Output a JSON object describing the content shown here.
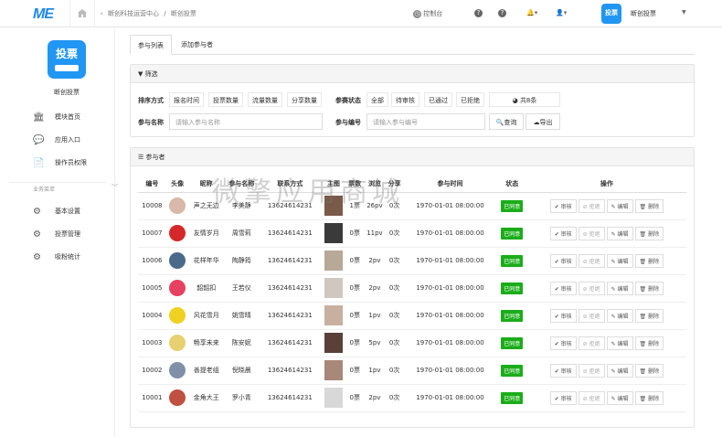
{
  "topbar": {
    "logo": "ME",
    "breadcrumb": [
      "断创科技运营中心",
      "/",
      "断创投票"
    ],
    "console": "控制台",
    "user": "断创投票",
    "avatar_text": "投票"
  },
  "sidebar": {
    "brand_logo_text": "投票",
    "brand_name": "断创投票",
    "items": [
      {
        "label": "模块首页",
        "icon": "bank-icon"
      },
      {
        "label": "应用入口",
        "icon": "chat-icon"
      },
      {
        "label": "操作员权限",
        "icon": "document-icon"
      }
    ],
    "section_label": "业务菜单",
    "biz_items": [
      {
        "label": "基本设置",
        "icon": "gear-icon"
      },
      {
        "label": "投票管理",
        "icon": "gear-icon"
      },
      {
        "label": "吸粉统计",
        "icon": "gear-icon"
      }
    ]
  },
  "tabs": [
    "参与列表",
    "添加参与者"
  ],
  "filter": {
    "title": "筛选",
    "sort_label": "排序方式",
    "sort_options": [
      "报名时间",
      "投票数量",
      "流量数量",
      "分享数量"
    ],
    "status_label": "参赛状态",
    "status_options": [
      "全部",
      "待审核",
      "已通过",
      "已拒绝"
    ],
    "total": "共8条",
    "name_label": "参与名称",
    "name_placeholder": "请输入参与名称",
    "num_label": "参与编号",
    "num_placeholder": "请输入参与编号",
    "search_btn": "查询",
    "export_btn": "导出"
  },
  "list": {
    "title": "参与者",
    "columns": [
      "编号",
      "头像",
      "昵称",
      "参与名称",
      "联系方式",
      "主图",
      "票数",
      "浏览",
      "分享",
      "参与时间",
      "状态",
      "操作"
    ],
    "ops": [
      "审核",
      "拒绝",
      "编辑",
      "删除"
    ],
    "rows": [
      {
        "id": "10008",
        "nick": "声之无边",
        "name": "李美静",
        "phone": "13624614231",
        "votes": "1票",
        "views": "26pv",
        "shares": "0次",
        "time": "1970-01-01 08:00:00",
        "status": "已同意",
        "avatar_color": "#d8b8a8",
        "img_color": "#7a5a48"
      },
      {
        "id": "10007",
        "nick": "友情岁月",
        "name": "周雪莉",
        "phone": "13624614231",
        "votes": "0票",
        "views": "11pv",
        "shares": "0次",
        "time": "1970-01-01 08:00:00",
        "status": "已同意",
        "avatar_color": "#d62828",
        "img_color": "#3a3a3a"
      },
      {
        "id": "10006",
        "nick": "花样年华",
        "name": "陶静筠",
        "phone": "13624614231",
        "votes": "0票",
        "views": "2pv",
        "shares": "0次",
        "time": "1970-01-01 08:00:00",
        "status": "已同意",
        "avatar_color": "#4a6a8a",
        "img_color": "#b8a898"
      },
      {
        "id": "10005",
        "nick": "韶韶扣",
        "name": "王若仪",
        "phone": "13624614231",
        "votes": "0票",
        "views": "2pv",
        "shares": "0次",
        "time": "1970-01-01 08:00:00",
        "status": "已同意",
        "avatar_color": "#e84060",
        "img_color": "#d0c8c0"
      },
      {
        "id": "10004",
        "nick": "风花雪月",
        "name": "姚雪晴",
        "phone": "13624614231",
        "votes": "0票",
        "views": "1pv",
        "shares": "0次",
        "time": "1970-01-01 08:00:00",
        "status": "已同意",
        "avatar_color": "#f0d020",
        "img_color": "#c8b0a0"
      },
      {
        "id": "10003",
        "nick": "畅享未来",
        "name": "陈安妮",
        "phone": "13624614231",
        "votes": "0票",
        "views": "5pv",
        "shares": "0次",
        "time": "1970-01-01 08:00:00",
        "status": "已同意",
        "avatar_color": "#e8d070",
        "img_color": "#5a4038"
      },
      {
        "id": "10002",
        "nick": "善提老组",
        "name": "倪晓晨",
        "phone": "13624614231",
        "votes": "0票",
        "views": "1pv",
        "shares": "0次",
        "time": "1970-01-01 08:00:00",
        "status": "已同意",
        "avatar_color": "#8090a8",
        "img_color": "#a88878"
      },
      {
        "id": "10001",
        "nick": "金角大王",
        "name": "罗小青",
        "phone": "13624614231",
        "votes": "0票",
        "views": "2pv",
        "shares": "0次",
        "time": "1970-01-01 08:00:00",
        "status": "已同意",
        "avatar_color": "#c05040",
        "img_color": "#d8d8d8"
      }
    ]
  },
  "watermark": "微擎应用商城"
}
